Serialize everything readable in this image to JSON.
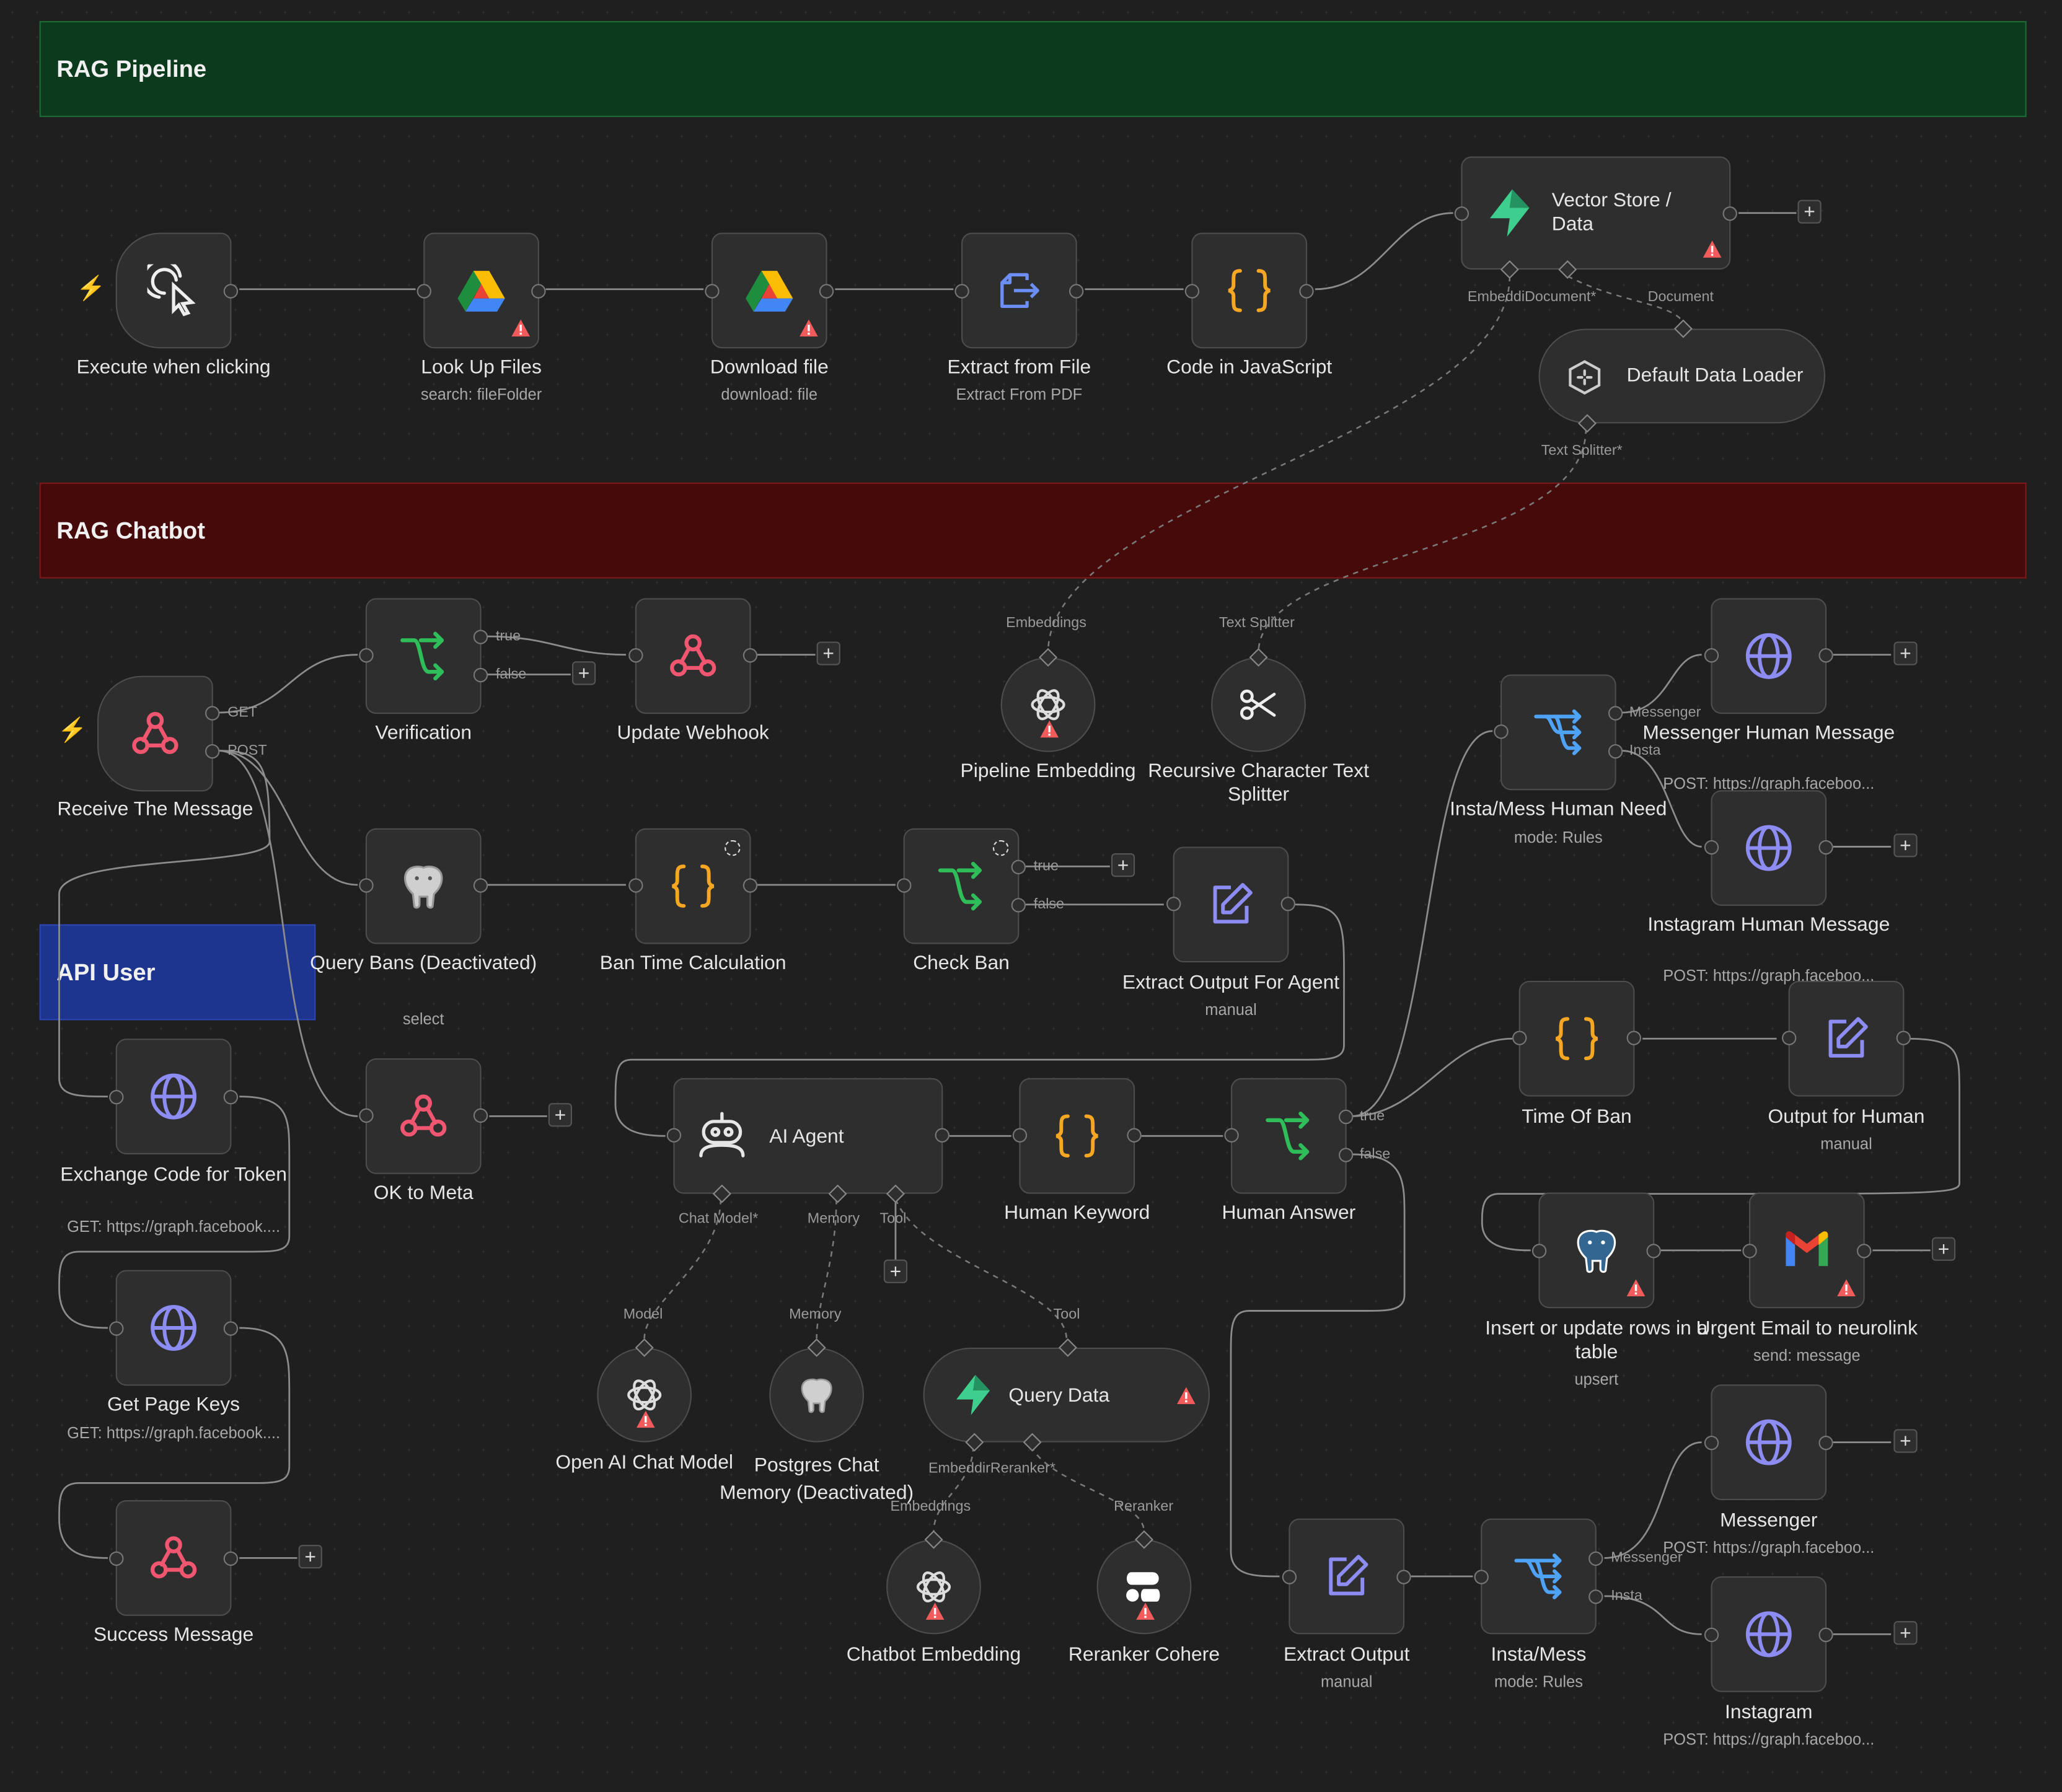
{
  "sections": {
    "rag_pipeline": "RAG Pipeline",
    "rag_chatbot": "RAG Chatbot",
    "api_user": "API User"
  },
  "colors": {
    "pipeline_bg": "#0b3a1c",
    "chatbot_bg": "#470a0b",
    "api_bg": "#1e3590",
    "wire": "#8c8c8c"
  },
  "nodes": {
    "execute": {
      "label": "Execute when clicking",
      "icon": "cursor-click-icon"
    },
    "lookup": {
      "label": "Look Up Files",
      "sub": "search: fileFolder",
      "icon": "google-drive-icon"
    },
    "download": {
      "label": "Download file",
      "sub": "download: file",
      "icon": "google-drive-icon"
    },
    "extract_file": {
      "label": "Extract from File",
      "sub": "Extract From PDF",
      "icon": "file-export-icon"
    },
    "code_js": {
      "label": "Code in JavaScript",
      "icon": "code-braces-icon"
    },
    "vector_store": {
      "label": "Vector Store / Data",
      "icon": "supabase-icon"
    },
    "default_loader": {
      "label": "Default Data Loader",
      "icon": "loader-icon"
    },
    "receive": {
      "label": "Receive The Message",
      "icon": "webhook-icon"
    },
    "verification": {
      "label": "Verification",
      "icon": "if-icon"
    },
    "update_webhook": {
      "label": "Update Webhook",
      "icon": "webhook-icon"
    },
    "pipeline_embedding": {
      "label": "Pipeline Embedding",
      "icon": "openai-icon"
    },
    "recursive_splitter": {
      "label": "Recursive Character Text Splitter",
      "icon": "scissors-icon"
    },
    "insta_mess_human_need": {
      "label": "Insta/Mess Human Need",
      "sub": "mode: Rules",
      "icon": "switch-icon"
    },
    "messenger_human_message": {
      "label": "Messenger Human Message",
      "sub": "POST: https://graph.faceboo...",
      "icon": "globe-icon"
    },
    "instagram_human_message": {
      "label": "Instagram Human Message",
      "sub": "POST: https://graph.faceboo...",
      "icon": "globe-icon"
    },
    "query_bans": {
      "label": "Query Bans (Deactivated)",
      "sub": "select",
      "icon": "postgres-icon"
    },
    "ban_time": {
      "label": "Ban Time Calculation",
      "icon": "code-braces-icon"
    },
    "check_ban": {
      "label": "Check Ban",
      "icon": "if-icon"
    },
    "extract_output_agent": {
      "label": "Extract Output For Agent",
      "sub": "manual",
      "icon": "edit-icon"
    },
    "exchange_code": {
      "label": "Exchange Code for Token",
      "sub": "GET: https://graph.facebook....",
      "icon": "globe-icon"
    },
    "ok_meta": {
      "label": "OK to Meta",
      "icon": "webhook-icon"
    },
    "ai_agent": {
      "label": "AI Agent",
      "icon": "robot-icon"
    },
    "human_keyword": {
      "label": "Human Keyword",
      "icon": "code-braces-icon"
    },
    "human_answer": {
      "label": "Human Answer",
      "icon": "if-icon"
    },
    "time_of_ban": {
      "label": "Time Of Ban",
      "icon": "code-braces-icon"
    },
    "output_human": {
      "label": "Output for Human",
      "sub": "manual",
      "icon": "edit-icon"
    },
    "get_page_keys": {
      "label": "Get Page Keys",
      "sub": "GET: https://graph.facebook....",
      "icon": "globe-icon"
    },
    "insert_update": {
      "label": "Insert or update rows in a table",
      "sub": "upsert",
      "icon": "postgres-icon"
    },
    "urgent_email": {
      "label": "Urgent Email to neurolink",
      "sub": "send: message",
      "icon": "gmail-icon"
    },
    "open_ai_chat": {
      "label": "Open AI Chat Model",
      "icon": "openai-icon"
    },
    "postgres_memory": {
      "label": "Postgres Chat Memory (Deactivated)",
      "icon": "postgres-icon"
    },
    "query_data": {
      "label": "Query Data",
      "icon": "supabase-icon"
    },
    "success_message": {
      "label": "Success Message",
      "icon": "webhook-icon"
    },
    "messenger": {
      "label": "Messenger",
      "sub": "POST: https://graph.faceboo...",
      "icon": "globe-icon"
    },
    "chatbot_embedding": {
      "label": "Chatbot Embedding",
      "icon": "openai-icon"
    },
    "reranker_cohere": {
      "label": "Reranker Cohere",
      "icon": "cohere-icon"
    },
    "extract_output": {
      "label": "Extract Output",
      "sub": "manual",
      "icon": "edit-icon"
    },
    "insta_mess": {
      "label": "Insta/Mess",
      "sub": "mode: Rules",
      "icon": "switch-icon"
    },
    "instagram": {
      "label": "Instagram",
      "sub": "POST: https://graph.faceboo...",
      "icon": "globe-icon"
    }
  },
  "ports": {
    "embeddi_star": "EmbeddiDocument*",
    "document": "Document",
    "text_splitter_star": "Text Splitter*",
    "get": "GET",
    "post": "POST",
    "true": "true",
    "false": "false",
    "embeddings": "Embeddings",
    "text_splitter": "Text Splitter",
    "messenger": "Messenger",
    "insta": "Insta",
    "chat_model_star": "Chat Model*",
    "memory": "Memory",
    "tool": "Tool",
    "model": "Model",
    "embeddi_reranker_star": "EmbeddirReranker*",
    "reranker": "Reranker"
  }
}
